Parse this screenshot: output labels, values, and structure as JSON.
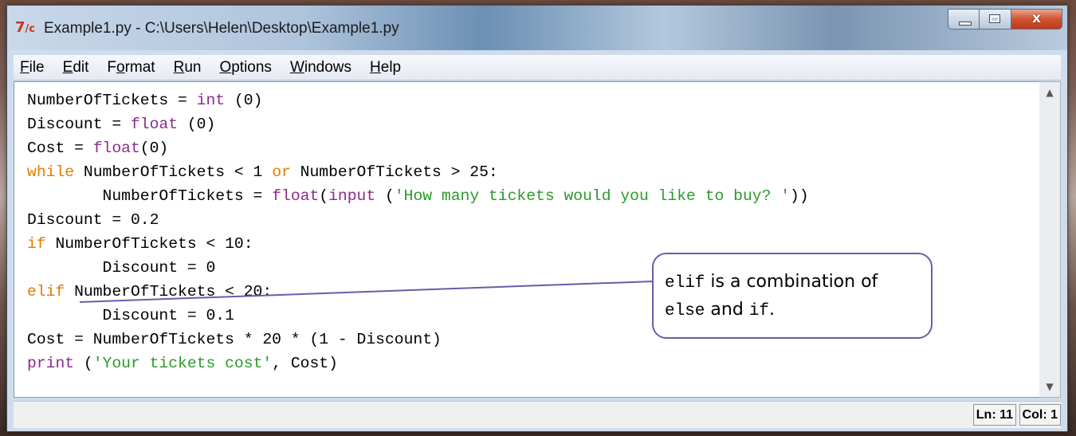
{
  "window": {
    "app_icon": "python-idle-icon",
    "title": "Example1.py - C:\\Users\\Helen\\Desktop\\Example1.py",
    "controls": {
      "minimize": "minimize-icon",
      "maximize": "maximize-icon",
      "close": "x"
    }
  },
  "menu": {
    "items": [
      {
        "label": "File",
        "accel": "F",
        "rest": "ile"
      },
      {
        "label": "Edit",
        "accel": "E",
        "rest": "dit"
      },
      {
        "label": "Format",
        "pre": "F",
        "accel": "o",
        "rest": "rmat"
      },
      {
        "label": "Run",
        "accel": "R",
        "rest": "un"
      },
      {
        "label": "Options",
        "accel": "O",
        "rest": "ptions"
      },
      {
        "label": "Windows",
        "accel": "W",
        "rest": "indows"
      },
      {
        "label": "Help",
        "accel": "H",
        "rest": "elp"
      }
    ]
  },
  "code": {
    "lines": [
      [
        {
          "t": "NumberOfTickets = ",
          "c": "plain"
        },
        {
          "t": "int",
          "c": "bi"
        },
        {
          "t": " (0)",
          "c": "plain"
        }
      ],
      [
        {
          "t": "Discount = ",
          "c": "plain"
        },
        {
          "t": "float",
          "c": "bi"
        },
        {
          "t": " (0)",
          "c": "plain"
        }
      ],
      [
        {
          "t": "Cost = ",
          "c": "plain"
        },
        {
          "t": "float",
          "c": "bi"
        },
        {
          "t": "(0)",
          "c": "plain"
        }
      ],
      [
        {
          "t": "while",
          "c": "kw"
        },
        {
          "t": " NumberOfTickets < 1 ",
          "c": "plain"
        },
        {
          "t": "or",
          "c": "kw"
        },
        {
          "t": " NumberOfTickets > 25:",
          "c": "plain"
        }
      ],
      [
        {
          "t": "        NumberOfTickets = ",
          "c": "plain"
        },
        {
          "t": "float",
          "c": "bi"
        },
        {
          "t": "(",
          "c": "plain"
        },
        {
          "t": "input",
          "c": "bi"
        },
        {
          "t": " (",
          "c": "plain"
        },
        {
          "t": "'How many tickets would you like to buy? '",
          "c": "str"
        },
        {
          "t": "))",
          "c": "plain"
        }
      ],
      [
        {
          "t": "Discount = 0.2",
          "c": "plain"
        }
      ],
      [
        {
          "t": "if",
          "c": "kw"
        },
        {
          "t": " NumberOfTickets < 10:",
          "c": "plain"
        }
      ],
      [
        {
          "t": "        Discount = 0",
          "c": "plain"
        }
      ],
      [
        {
          "t": "elif",
          "c": "kw"
        },
        {
          "t": " NumberOfTickets < 20:",
          "c": "plain"
        }
      ],
      [
        {
          "t": "        Discount = 0.1",
          "c": "plain"
        }
      ],
      [
        {
          "t": "Cost = NumberOfTickets * 20 * (1 - Discount)",
          "c": "plain"
        }
      ],
      [
        {
          "t": "print",
          "c": "bi"
        },
        {
          "t": " (",
          "c": "plain"
        },
        {
          "t": "'Your tickets cost'",
          "c": "str"
        },
        {
          "t": ", Cost)",
          "c": "plain"
        }
      ]
    ]
  },
  "callout": {
    "line1_code": "elif",
    "line1_text": " is a combination of",
    "line2_code": "else",
    "line2_mid": " and ",
    "line2_code2": "if",
    "line2_end": "."
  },
  "status": {
    "line": "Ln: 11",
    "col": "Col: 1"
  },
  "colors": {
    "keyword": "#e27b00",
    "builtin": "#8c2b8c",
    "string": "#2a9a2a",
    "callout_border": "#6b5ca8"
  }
}
